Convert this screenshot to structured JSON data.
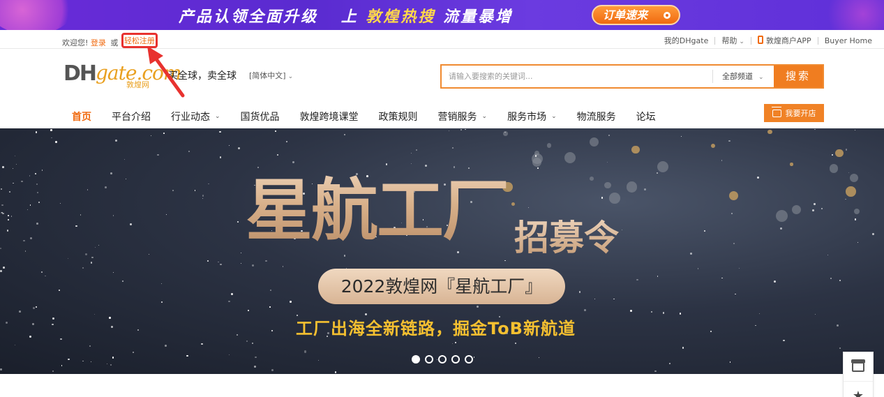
{
  "promo": {
    "text_a": "产品认领全面升级",
    "text_b": "上",
    "text_c": "敦煌热搜",
    "text_d": "流量暴增",
    "button": "订单速来"
  },
  "topbar": {
    "welcome": "欢迎您!",
    "login": "登录",
    "or": "或",
    "register": "轻松注册",
    "my_dhgate": "我的DHgate",
    "help": "帮助",
    "merchant_app": "敦煌商户APP",
    "buyer_home": "Buyer Home"
  },
  "header": {
    "logo_dh": "DH",
    "logo_gate": "gate.com",
    "logo_cn": "敦煌网",
    "slogan": "买全球，卖全球",
    "language": "[简体中文]",
    "search_placeholder": "请输入要搜索的关键词...",
    "search_channel": "全部频道",
    "search_button": "搜索",
    "open_shop": "我要开店"
  },
  "nav": [
    {
      "label": "首页",
      "active": true,
      "dropdown": false
    },
    {
      "label": "平台介绍",
      "active": false,
      "dropdown": false
    },
    {
      "label": "行业动态",
      "active": false,
      "dropdown": true
    },
    {
      "label": "国货优品",
      "active": false,
      "dropdown": false
    },
    {
      "label": "敦煌跨境课堂",
      "active": false,
      "dropdown": false
    },
    {
      "label": "政策规则",
      "active": false,
      "dropdown": false
    },
    {
      "label": "营销服务",
      "active": false,
      "dropdown": true
    },
    {
      "label": "服务市场",
      "active": false,
      "dropdown": true
    },
    {
      "label": "物流服务",
      "active": false,
      "dropdown": false
    },
    {
      "label": "论坛",
      "active": false,
      "dropdown": false
    }
  ],
  "hero": {
    "title": "星航工厂",
    "subtitle": "招募令",
    "pill": "2022敦煌网『星航工厂』",
    "tagline": "工厂出海全新链路，掘金ToB新航道",
    "slide_count": 5,
    "active_slide": 1
  },
  "colors": {
    "accent": "#f07d20",
    "highlight_box": "#e8322f"
  }
}
